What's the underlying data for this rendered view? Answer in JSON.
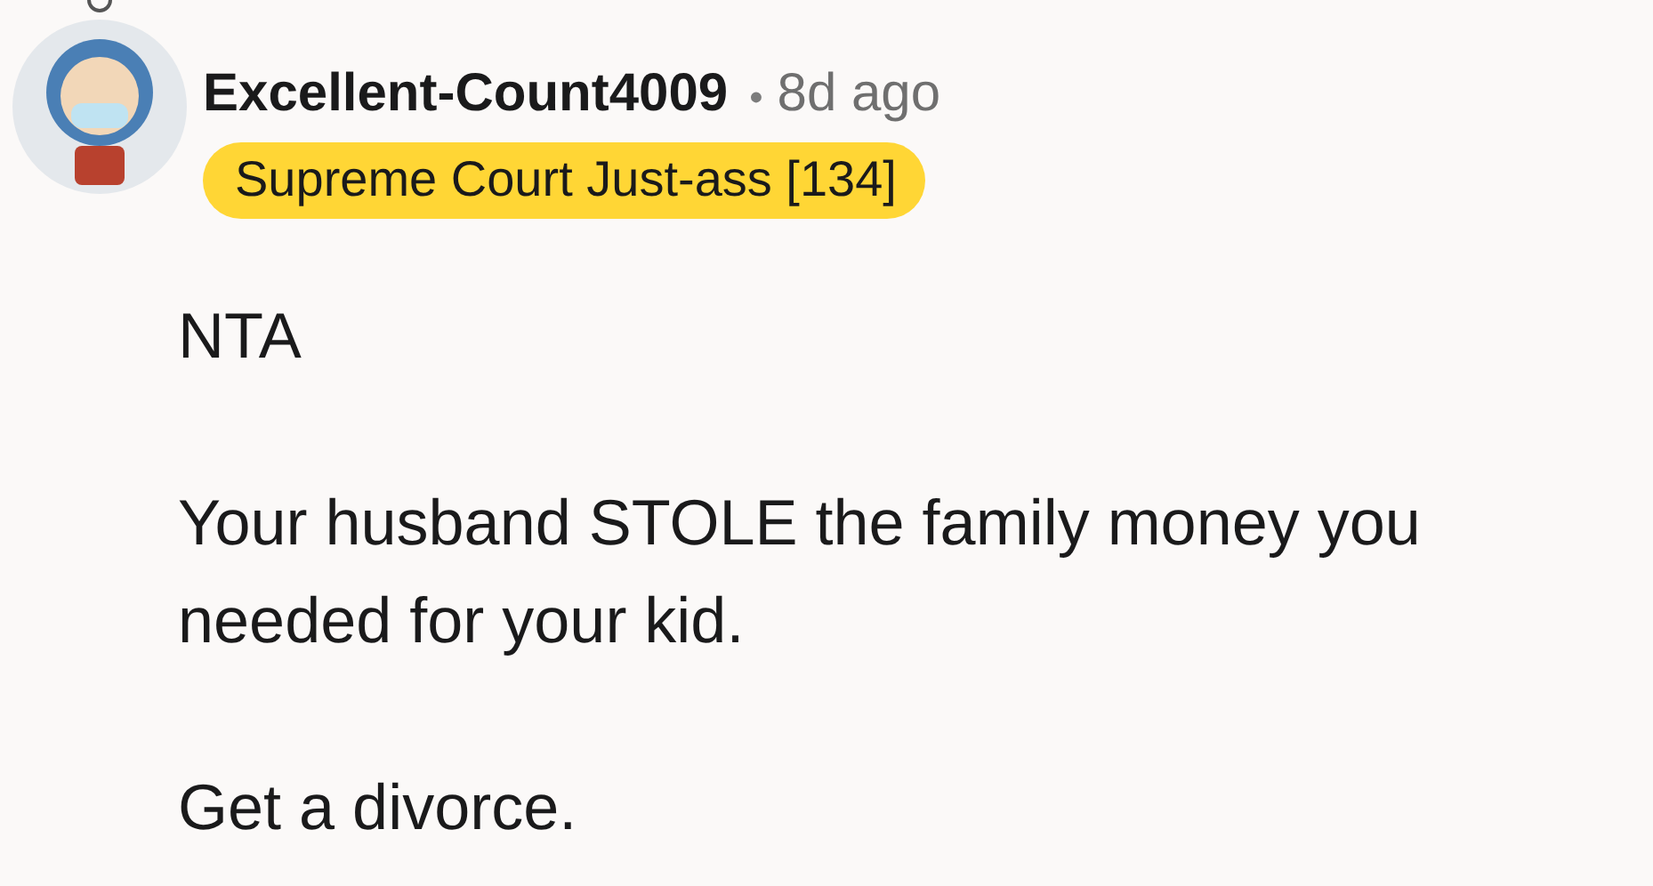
{
  "comment": {
    "author": "Excellent-Count4009",
    "separator": "•",
    "time": "8d ago",
    "flair": "Supreme Court Just-ass [134]",
    "paragraphs": [
      "NTA",
      "Your husband STOLE the family money you needed for your kid.",
      "Get a divorce."
    ]
  }
}
